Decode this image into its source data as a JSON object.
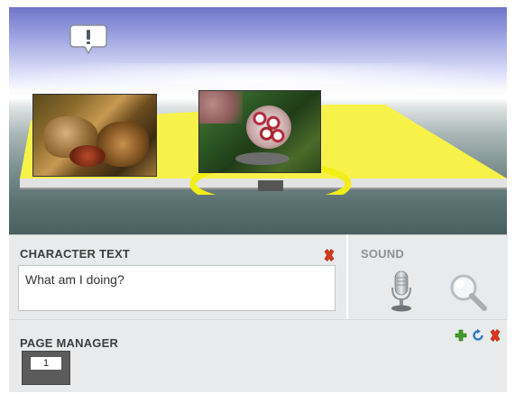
{
  "stage": {
    "speech_icon": "exclamation-speech-bubble-icon",
    "floor_color": "#f7f24a",
    "highlight_ring_color": "#f2ee17"
  },
  "character_text": {
    "title": "CHARACTER TEXT",
    "value": "What am I doing?",
    "delete_icon": "red-x-icon"
  },
  "sound": {
    "title": "SOUND",
    "mic_icon": "microphone-icon",
    "search_icon": "magnifier-icon"
  },
  "page_manager": {
    "title": "PAGE MANAGER",
    "pages": [
      "1"
    ],
    "tools": [
      "add-icon",
      "refresh-icon",
      "delete-icon"
    ]
  },
  "colors": {
    "delete_red": "#d8381c",
    "add_green": "#3f9c2a",
    "refresh_blue": "#2474c8"
  }
}
